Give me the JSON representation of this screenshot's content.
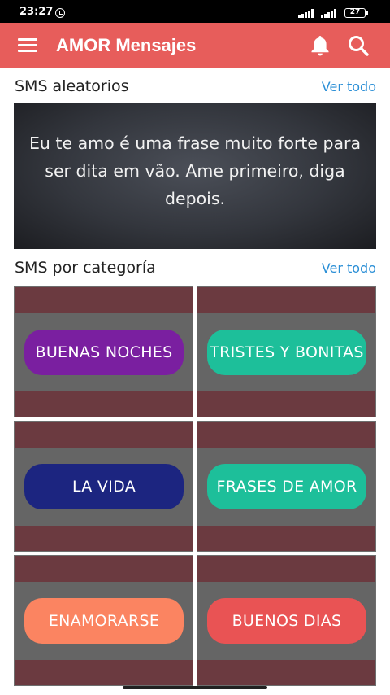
{
  "status_bar": {
    "time": "23:27",
    "battery": "27",
    "icons": [
      "alarm-icon",
      "signal-icon",
      "signal-icon",
      "battery-icon"
    ]
  },
  "app_bar": {
    "title": "AMOR Mensajes",
    "background_color": "#e75d5b",
    "icons": [
      "menu-icon",
      "bell-icon",
      "search-icon"
    ]
  },
  "random_section": {
    "title": "SMS aleatorios",
    "see_all": "Ver todo",
    "message": "Eu te amo é uma frase muito forte para ser dita em vão. Ame primeiro, diga depois."
  },
  "category_section": {
    "title": "SMS por categoría",
    "see_all": "Ver todo",
    "categories": [
      {
        "label": "BUENAS NOCHES",
        "color": "#7a1fa0"
      },
      {
        "label": "TRISTES Y BONITAS",
        "color": "#1dbf9a"
      },
      {
        "label": "LA VIDA",
        "color": "#1c2580"
      },
      {
        "label": "FRASES DE AMOR",
        "color": "#1dbf9a"
      },
      {
        "label": "ENAMORARSE",
        "color": "#fb8461"
      },
      {
        "label": "BUENOS DIAS",
        "color": "#e95354"
      }
    ]
  },
  "colors": {
    "accent": "#2b8fd6",
    "tile_band": "#6b3a40",
    "tile_body": "#656565"
  }
}
